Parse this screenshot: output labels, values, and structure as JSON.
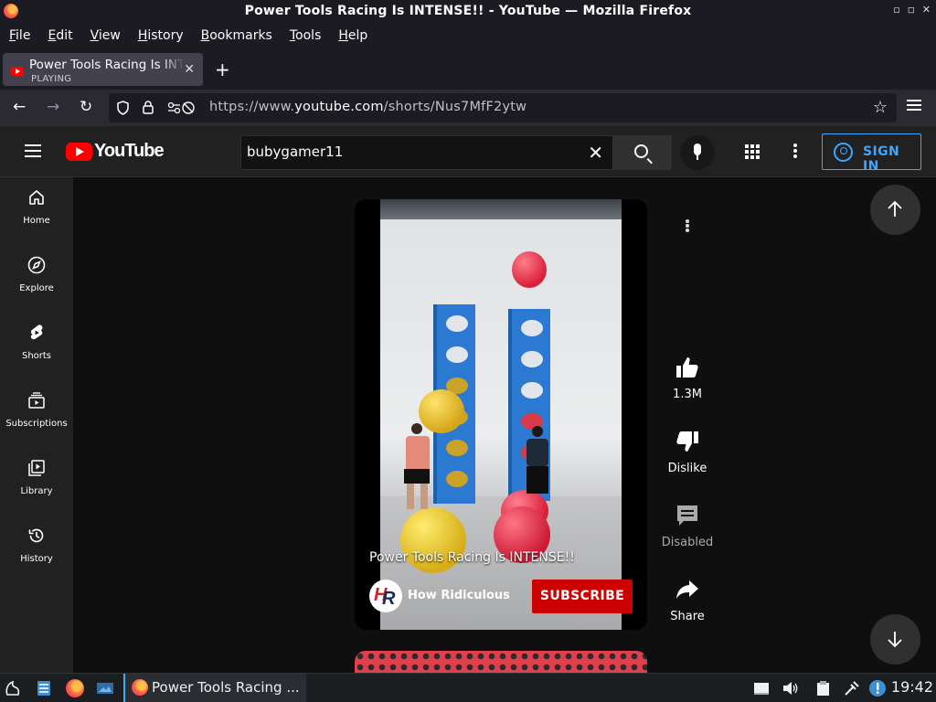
{
  "window": {
    "title": "Power Tools Racing Is INTENSE!! - YouTube — Mozilla Firefox",
    "controls": [
      "▫",
      "◽",
      "✕"
    ]
  },
  "menubar": [
    {
      "label": "File",
      "key": "F"
    },
    {
      "label": "Edit",
      "key": "E"
    },
    {
      "label": "View",
      "key": "V"
    },
    {
      "label": "History",
      "key": "H"
    },
    {
      "label": "Bookmarks",
      "key": "B"
    },
    {
      "label": "Tools",
      "key": "T"
    },
    {
      "label": "Help",
      "key": "H"
    }
  ],
  "tab": {
    "title": "Power Tools Racing Is INTENSE!! - YouTube",
    "status": "PLAYING"
  },
  "urlbar": {
    "prefix": "https://www.",
    "domain": "youtube.com",
    "path": "/shorts/Nus7MfF2ytw"
  },
  "youtube": {
    "logo": "YouTube",
    "search_value": "bubygamer11",
    "sign_in": "SIGN IN",
    "guide": [
      {
        "label": "Home",
        "icon": "home-icon"
      },
      {
        "label": "Explore",
        "icon": "compass-icon"
      },
      {
        "label": "Shorts",
        "icon": "shorts-icon"
      },
      {
        "label": "Subscriptions",
        "icon": "subscriptions-icon"
      },
      {
        "label": "Library",
        "icon": "library-icon"
      },
      {
        "label": "History",
        "icon": "history-icon"
      }
    ],
    "short": {
      "caption": "Power Tools Racing Is INTENSE!!",
      "channel": "How Ridiculous",
      "subscribe": "SUBSCRIBE"
    },
    "actions": {
      "likes": "1.3M",
      "dislike": "Dislike",
      "comments": "Disabled",
      "share": "Share"
    }
  },
  "taskbar": {
    "task_title": "Power Tools Racing ...",
    "clock": "19:42"
  },
  "colors": {
    "yt_red": "#ff0000",
    "subscribe_red": "#cc0000",
    "signin_blue": "#3ea6ff",
    "firefox_chrome": "#1c1b22"
  }
}
